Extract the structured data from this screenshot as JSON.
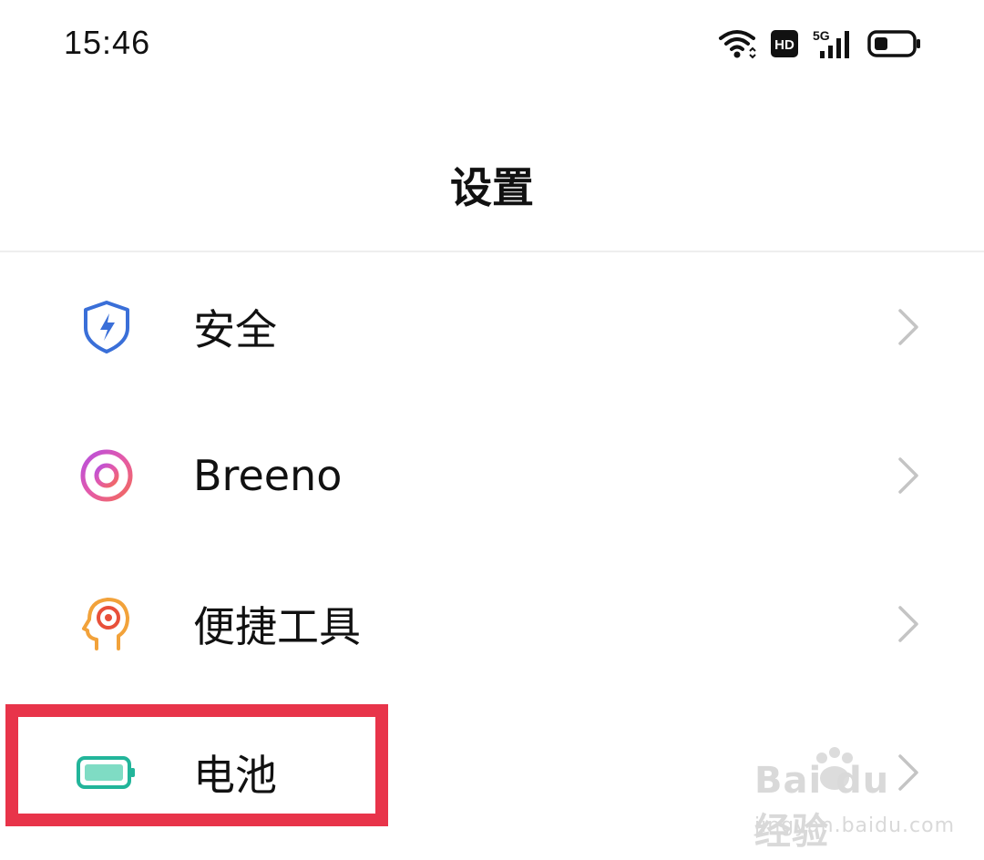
{
  "status_bar": {
    "time": "15:46",
    "icons": [
      "wifi-icon",
      "hd-icon",
      "signal-5g-icon",
      "battery-icon"
    ],
    "hd_label": "HD",
    "network_label": "5G"
  },
  "header": {
    "title": "设置"
  },
  "settings": {
    "items": [
      {
        "label": "安全",
        "icon": "shield-lightning-icon",
        "accent": "#3a6fd8"
      },
      {
        "label": "Breeno",
        "icon": "breeno-ring-icon",
        "accent": "#c84fd6"
      },
      {
        "label": "便捷工具",
        "icon": "head-target-icon",
        "accent": "#f2a23a"
      },
      {
        "label": "电池",
        "icon": "battery-icon",
        "accent": "#22b59a"
      }
    ]
  },
  "highlight": {
    "color": "#e8344a",
    "target": "电池"
  },
  "watermark": {
    "logo_text": "Bai du 经验",
    "url": "jingyan.baidu.com"
  }
}
